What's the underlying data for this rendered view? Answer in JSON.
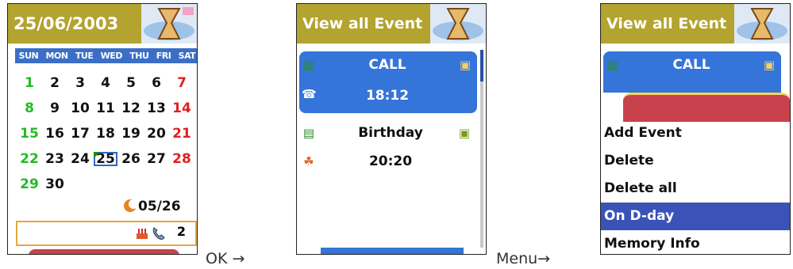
{
  "screen1": {
    "header_date": "25/06/2003",
    "weekdays": [
      "SUN",
      "MON",
      "TUE",
      "WED",
      "THU",
      "FRI",
      "SAT"
    ],
    "weeks": [
      [
        "",
        "",
        "",
        "",
        "",
        "",
        ""
      ],
      [
        "1",
        "2",
        "3",
        "4",
        "5",
        "6",
        "7"
      ],
      [
        "8",
        "9",
        "10",
        "11",
        "12",
        "13",
        "14"
      ],
      [
        "15",
        "16",
        "17",
        "18",
        "19",
        "20",
        "21"
      ],
      [
        "22",
        "23",
        "24",
        "25",
        "26",
        "27",
        "28"
      ],
      [
        "29",
        "30",
        "",
        "",
        "",
        "",
        ""
      ]
    ],
    "today": "25",
    "lunar_date": "05/26",
    "event_count": "2"
  },
  "label_ok": "OK →",
  "screen2": {
    "header_title": "View all Event",
    "events": [
      {
        "name": "CALL",
        "time": "18:12"
      },
      {
        "name": "Birthday",
        "time": "20:20"
      }
    ]
  },
  "label_menu": "Menu→",
  "screen3": {
    "header_title": "View all Event",
    "event_name": "CALL",
    "menu_items": [
      "Add Event",
      "Delete",
      "Delete all",
      "On D-day",
      "Memory Info"
    ],
    "selected_index": 3
  },
  "colors": {
    "header_olive": "#b3a32f",
    "selection_blue": "#3574d8",
    "menu_highlight": "#3b52b8",
    "sunday": "#22bb22",
    "saturday": "#e02020"
  }
}
